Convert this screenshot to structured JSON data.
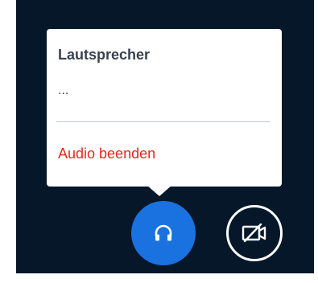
{
  "audio_menu": {
    "title": "Lautsprecher",
    "device_item": "...",
    "leave_audio_label": "Audio beenden"
  },
  "controls": {
    "audio_button_icon": "headphones-icon",
    "video_button_icon": "video-off-icon"
  },
  "colors": {
    "background": "#06172a",
    "accent": "#1a72e0",
    "danger": "#e02a1e"
  }
}
